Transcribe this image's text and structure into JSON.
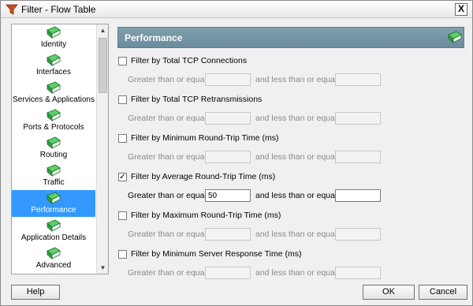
{
  "window": {
    "title": "Filter - Flow Table",
    "close_symbol": "X"
  },
  "nav": {
    "items": [
      {
        "label": "Identity"
      },
      {
        "label": "Interfaces"
      },
      {
        "label": "Services & Applications"
      },
      {
        "label": "Ports & Protocols"
      },
      {
        "label": "Routing"
      },
      {
        "label": "Traffic"
      },
      {
        "label": "Performance",
        "selected": true
      },
      {
        "label": "Application Details"
      },
      {
        "label": "Advanced"
      }
    ]
  },
  "section": {
    "title": "Performance"
  },
  "range_labels": {
    "greater": "Greater than or equal to",
    "less": "and less than or equal to"
  },
  "filters": [
    {
      "label": "Filter by Total TCP Connections",
      "checked": false,
      "min": "",
      "max": ""
    },
    {
      "label": "Filter by Total TCP Retransmissions",
      "checked": false,
      "min": "",
      "max": ""
    },
    {
      "label": "Filter by Minimum Round-Trip Time (ms)",
      "checked": false,
      "min": "",
      "max": ""
    },
    {
      "label": "Filter by Average Round-Trip Time (ms)",
      "checked": true,
      "min": "50",
      "max": ""
    },
    {
      "label": "Filter by Maximum Round-Trip Time (ms)",
      "checked": false,
      "min": "",
      "max": ""
    },
    {
      "label": "Filter by Minimum Server Response Time (ms)",
      "checked": false,
      "min": "",
      "max": ""
    }
  ],
  "buttons": {
    "help": "Help",
    "ok": "OK",
    "cancel": "Cancel"
  },
  "colors": {
    "selection": "#3399ff",
    "header": "#6f8f9f",
    "book_green": "#2e9e3e"
  }
}
